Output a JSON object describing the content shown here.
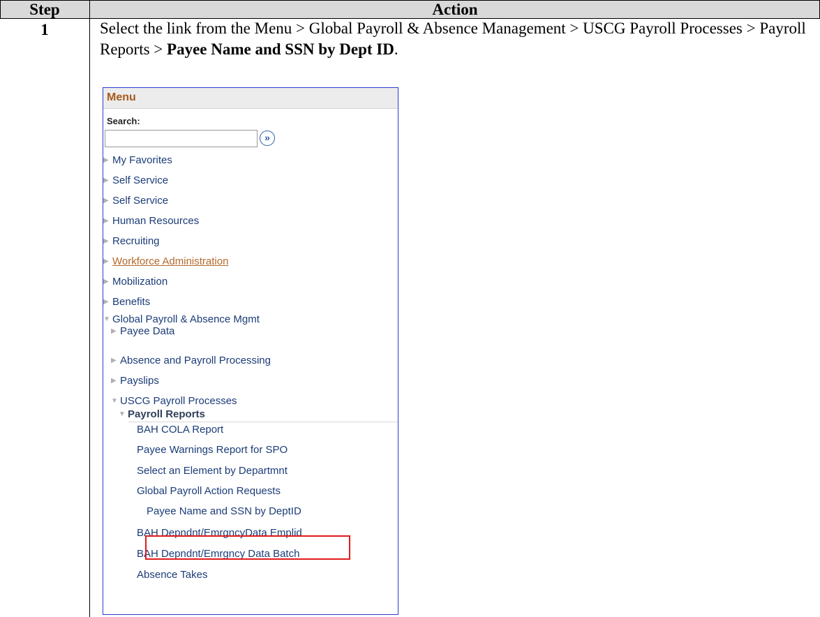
{
  "table": {
    "header_step": "Step",
    "header_action": "Action",
    "step_number": "1",
    "instruction_prefix": "Select the link from the Menu > Global Payroll & Absence Management > USCG Payroll Processes > Payroll Reports > ",
    "instruction_bold": "Payee Name and SSN by Dept ID",
    "instruction_suffix": "."
  },
  "menu": {
    "title": "Menu",
    "search_label": "Search:",
    "search_value": "",
    "go_glyph": "»",
    "items": [
      {
        "label": "My Favorites",
        "state": "collapsed"
      },
      {
        "label": "Self Service",
        "state": "collapsed"
      },
      {
        "label": "Self Service",
        "state": "collapsed"
      },
      {
        "label": "Human Resources",
        "state": "collapsed"
      },
      {
        "label": "Recruiting",
        "state": "collapsed"
      },
      {
        "label": "Workforce Administration",
        "state": "collapsed-link"
      },
      {
        "label": "Mobilization",
        "state": "collapsed"
      },
      {
        "label": "Benefits",
        "state": "collapsed"
      },
      {
        "label": "Global Payroll & Absence Mgmt",
        "state": "expanded"
      },
      {
        "label": "Payee Data",
        "state": "collapsed"
      },
      {
        "label": "Absence and Payroll Processing",
        "state": "collapsed"
      },
      {
        "label": "Payslips",
        "state": "collapsed"
      },
      {
        "label": "USCG Payroll Processes",
        "state": "expanded"
      },
      {
        "label": "Payroll Reports",
        "state": "expanded"
      },
      {
        "label": "BAH COLA Report",
        "state": "leaf"
      },
      {
        "label": "Payee Warnings Report for SPO",
        "state": "leaf"
      },
      {
        "label": "Select an Element by Departmnt",
        "state": "leaf"
      },
      {
        "label": "Global Payroll Action Requests",
        "state": "leaf"
      },
      {
        "label": "Payee Name and SSN by DeptID",
        "state": "leaf-highlighted"
      },
      {
        "label": "BAH Depndnt/EmrgncyData Emplid",
        "state": "leaf"
      },
      {
        "label": "BAH Depndnt/Emrgncy Data Batch",
        "state": "leaf"
      },
      {
        "label": "Absence Takes",
        "state": "leaf-cut-off"
      }
    ]
  },
  "colors": {
    "header_fill": "#d9d9d9",
    "menu_border": "#2c3ccf",
    "menu_title": "#a55a1c",
    "menu_link": "#1b3c78",
    "hover_link": "#b4692a",
    "highlight_box": "#e11b1b"
  },
  "icons": {
    "collapsed": "right-triangle-icon",
    "expanded": "down-triangle-icon",
    "go": "go-arrow-icon"
  }
}
